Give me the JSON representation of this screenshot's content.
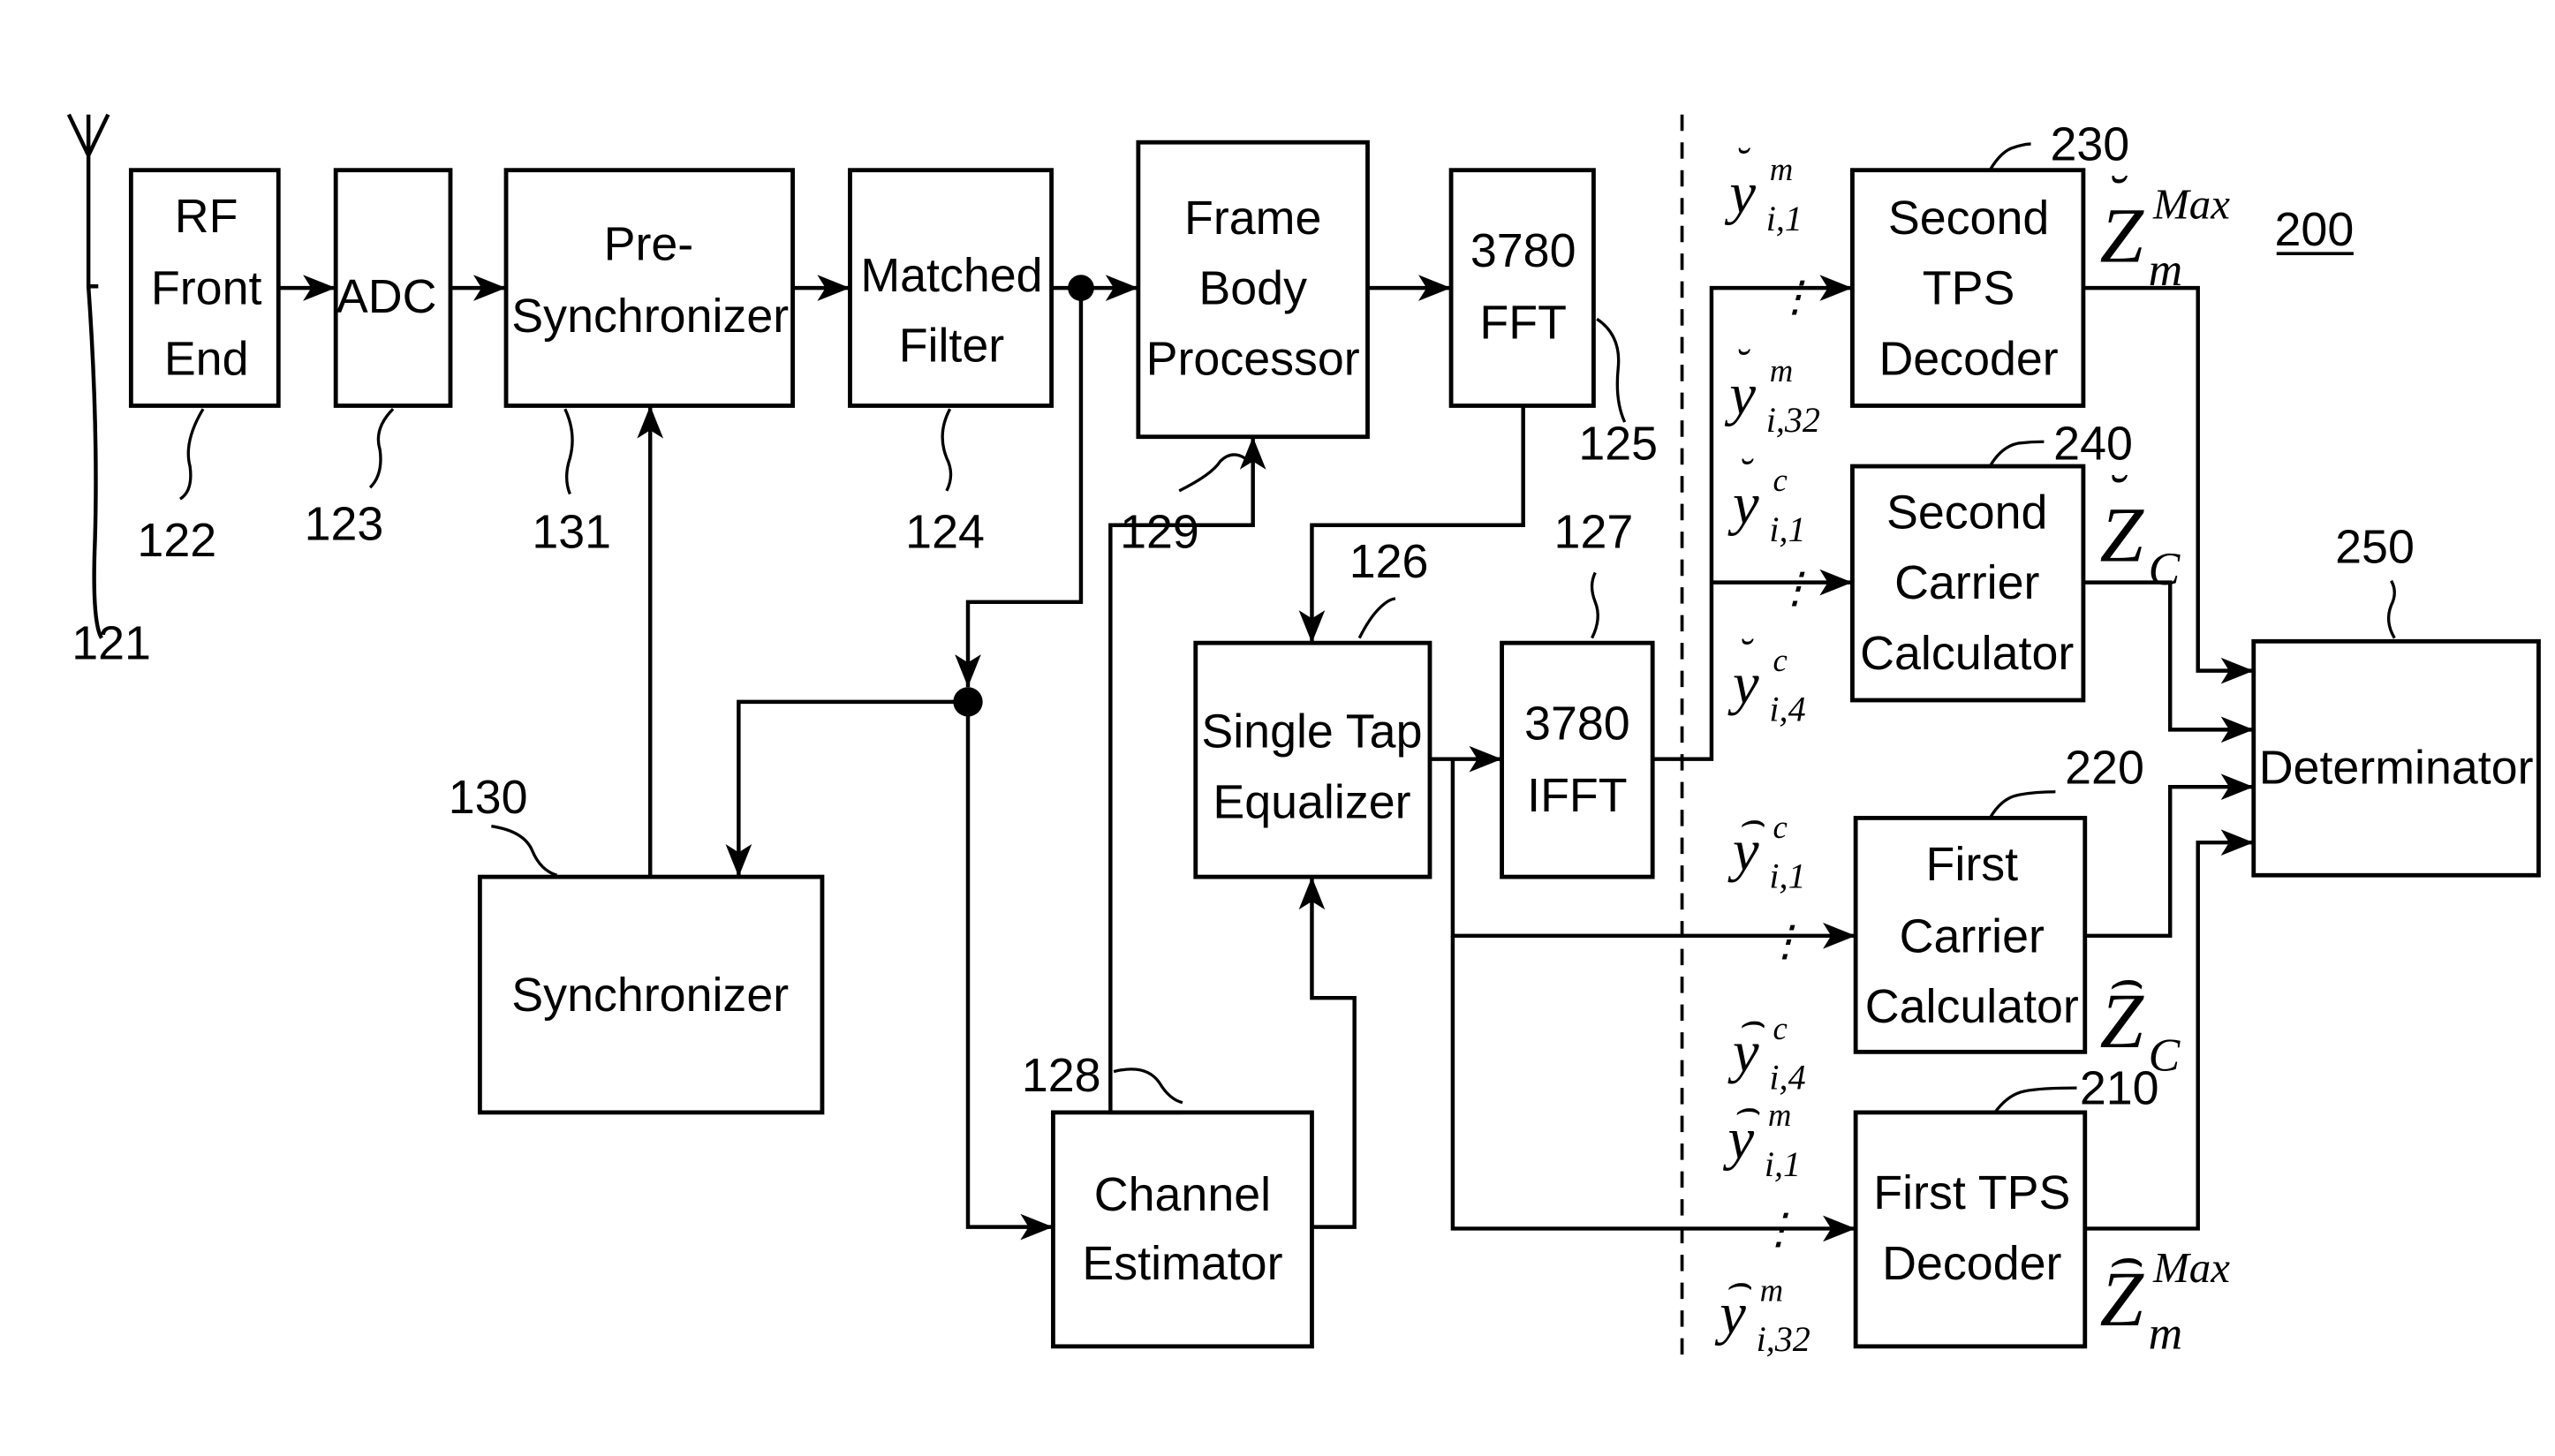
{
  "figure_number": "200",
  "blocks": {
    "rf_front_end": {
      "lines": [
        "RF",
        "Front",
        "End"
      ],
      "ref": "122"
    },
    "adc": {
      "lines": [
        "ADC"
      ],
      "ref": "123"
    },
    "pre_synchronizer": {
      "lines": [
        "Pre-",
        "Synchronizer"
      ],
      "ref": "131"
    },
    "matched_filter": {
      "lines": [
        "Matched",
        "Filter"
      ],
      "ref": "124"
    },
    "frame_body_processor": {
      "lines": [
        "Frame",
        "Body",
        "Processor"
      ],
      "ref": "129"
    },
    "fft": {
      "lines": [
        "3780",
        "FFT"
      ],
      "ref": "125"
    },
    "single_tap_equalizer": {
      "lines": [
        "Single Tap",
        "Equalizer"
      ],
      "ref": "126"
    },
    "ifft": {
      "lines": [
        "3780",
        "IFFT"
      ],
      "ref": "127"
    },
    "synchronizer": {
      "lines": [
        "Synchronizer"
      ],
      "ref": "130"
    },
    "channel_estimator": {
      "lines": [
        "Channel",
        "Estimator"
      ],
      "ref": "128"
    },
    "second_tps_decoder": {
      "lines": [
        "Second",
        "TPS",
        "Decoder"
      ],
      "ref": "230"
    },
    "second_carrier_calculator": {
      "lines": [
        "Second",
        "Carrier",
        "Calculator"
      ],
      "ref": "240"
    },
    "first_carrier_calculator": {
      "lines": [
        "First",
        "Carrier",
        "Calculator"
      ],
      "ref": "220"
    },
    "first_tps_decoder": {
      "lines": [
        "First TPS",
        "Decoder"
      ],
      "ref": "210"
    },
    "determinator": {
      "lines": [
        "Determinator"
      ],
      "ref": "250"
    }
  },
  "antenna": {
    "ref": "121"
  },
  "signals": {
    "second_tps_in_top": {
      "base": "y",
      "accent": "˘",
      "sup": "m",
      "sub": "i,1"
    },
    "second_tps_in_bottom": {
      "base": "y",
      "accent": "˘",
      "sup": "m",
      "sub": "i,32"
    },
    "second_carrier_in_top": {
      "base": "y",
      "accent": "˘",
      "sup": "c",
      "sub": "i,1"
    },
    "second_carrier_in_bottom": {
      "base": "y",
      "accent": "˘",
      "sup": "c",
      "sub": "i,4"
    },
    "first_carrier_in_top": {
      "base": "y",
      "accent": "⌢",
      "sup": "c",
      "sub": "i,1"
    },
    "first_carrier_in_bottom": {
      "base": "y",
      "accent": "⌢",
      "sup": "c",
      "sub": "i,4"
    },
    "first_tps_in_top": {
      "base": "y",
      "accent": "⌢",
      "sup": "m",
      "sub": "i,1"
    },
    "first_tps_in_bottom": {
      "base": "y",
      "accent": "⌢",
      "sup": "m",
      "sub": "i,32"
    },
    "second_tps_out": {
      "base": "Z",
      "accent": "˘",
      "sup": "Max",
      "sub": "m"
    },
    "second_carrier_out": {
      "base": "Z",
      "accent": "˘",
      "sup": "",
      "sub": "C"
    },
    "first_carrier_out": {
      "base": "Z",
      "accent": "⌢",
      "sup": "",
      "sub": "C"
    },
    "first_tps_out": {
      "base": "Z",
      "accent": "⌢",
      "sup": "Max",
      "sub": "m"
    }
  },
  "dots": "⋮"
}
